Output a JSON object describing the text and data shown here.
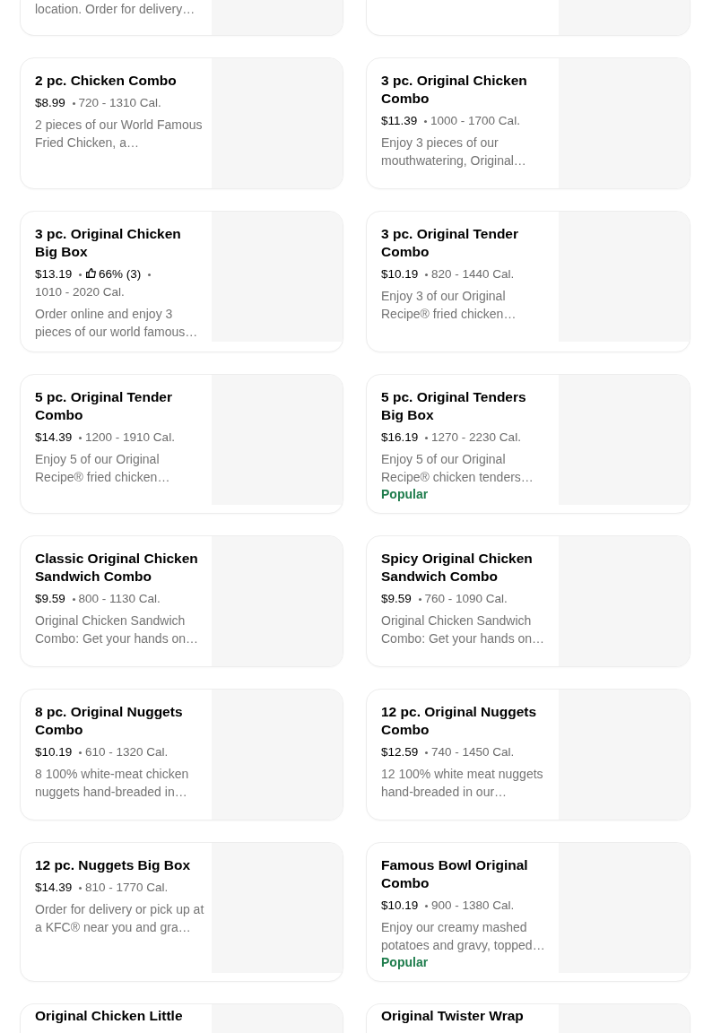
{
  "menu_items": [
    {
      "kind": "cut_top",
      "description": "location. Order for delivery…"
    },
    {
      "kind": "cut_top"
    },
    {
      "kind": "full",
      "title": "2 pc. Chicken Combo",
      "price": "$8.99",
      "calories": "720 - 1310 Cal.",
      "description": "2 pieces of our World Famous Fried Chicken, a…"
    },
    {
      "kind": "full",
      "title": "3 pc. Original Chicken Combo",
      "price": "$11.39",
      "calories": "1000 - 1700 Cal.",
      "description": "Enjoy 3 pieces of our mouthwatering, Original…"
    },
    {
      "kind": "full",
      "title": "3 pc. Original Chicken Big Box",
      "price": "$13.19",
      "rating": "66% (3)",
      "calories": "1010 - 2020 Cal.",
      "description": "Order online and enjoy 3 pieces of our world famous…"
    },
    {
      "kind": "full",
      "title": "3 pc. Original Tender Combo",
      "price": "$10.19",
      "calories": "820 - 1440 Cal.",
      "description": "Enjoy 3 of our Original Recipe® fried chicken…"
    },
    {
      "kind": "full",
      "title": "5 pc. Original Tender Combo",
      "price": "$14.39",
      "calories": "1200 - 1910 Cal.",
      "description": "Enjoy 5 of our Original Recipe® fried chicken…"
    },
    {
      "kind": "full",
      "title": "5 pc. Original Tenders Big Box",
      "price": "$16.19",
      "calories": "1270 - 2230 Cal.",
      "description": "Enjoy 5 of our Original Recipe® chicken tenders…",
      "badge": "Popular"
    },
    {
      "kind": "full",
      "title": "Classic Original Chicken Sandwich Combo",
      "price": "$9.59",
      "calories": "800 - 1130 Cal.",
      "description": "Original Chicken Sandwich Combo: Get your hands on…"
    },
    {
      "kind": "full",
      "title": "Spicy Original Chicken Sandwich Combo",
      "price": "$9.59",
      "calories": "760 - 1090 Cal.",
      "description": "Original Chicken Sandwich Combo: Get your hands on…"
    },
    {
      "kind": "full",
      "title": "8 pc. Original Nuggets Combo",
      "price": "$10.19",
      "calories": "610 - 1320 Cal.",
      "description": "8 100% white-meat chicken nuggets hand-breaded in…"
    },
    {
      "kind": "full",
      "title": "12 pc. Original Nuggets Combo",
      "price": "$12.59",
      "calories": "740 - 1450 Cal.",
      "description": "12 100% white meat nuggets hand-breaded in our…"
    },
    {
      "kind": "full",
      "title": "12 pc. Nuggets Big Box",
      "price": "$14.39",
      "calories": "810 - 1770 Cal.",
      "description": "Order for delivery or pick up at a KFC® near you and gra…"
    },
    {
      "kind": "full",
      "title": "Famous Bowl Original Combo",
      "price": "$10.19",
      "calories": "900 - 1380 Cal.",
      "description": "Enjoy our creamy mashed potatoes and gravy, topped…",
      "badge": "Popular"
    },
    {
      "kind": "cut_bottom",
      "title": "Original Chicken Little"
    },
    {
      "kind": "cut_bottom",
      "title": "Original Twister Wrap"
    }
  ]
}
